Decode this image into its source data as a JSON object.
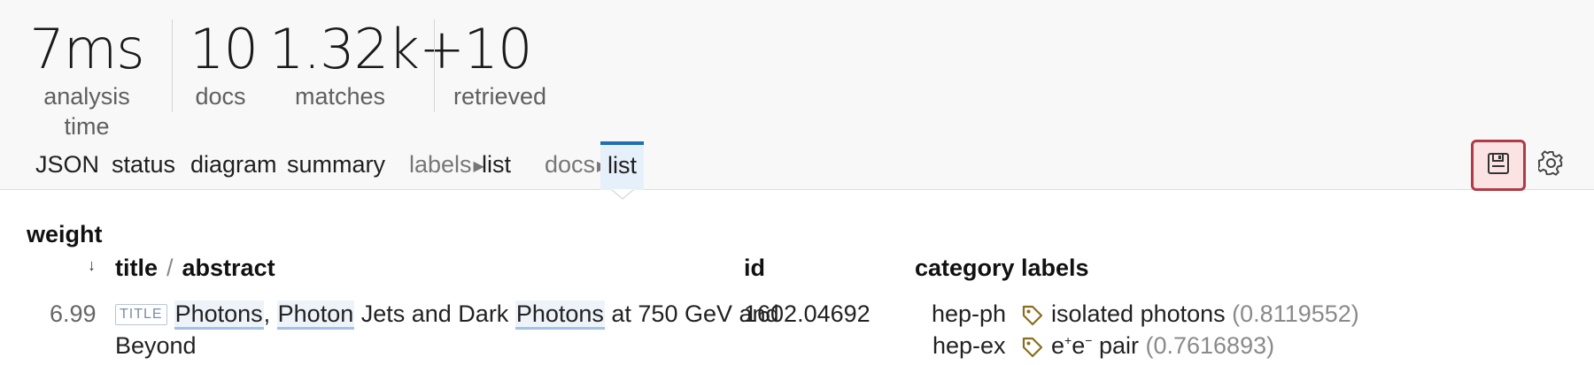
{
  "stats": [
    {
      "value": "7ms",
      "label": "analysis time"
    },
    {
      "value": "10",
      "label": "docs"
    },
    {
      "value": "1.32k+",
      "label": "matches"
    },
    {
      "value": "10",
      "label": "retrieved"
    }
  ],
  "tabs": {
    "json": "JSON",
    "status": "status",
    "diagram": "diagram",
    "summary": "summary",
    "labels_group": "labels",
    "labels_list": "list",
    "docs_group": "docs",
    "docs_list": "list",
    "active": "docs_list"
  },
  "toolbar": {
    "save_icon": "floppy-disk-icon",
    "settings_icon": "gear-icon",
    "save_highlight_color": "#b03a46"
  },
  "table": {
    "headers": {
      "weight": "weight",
      "title": "title",
      "separator": "/",
      "abstract": "abstract",
      "id": "id",
      "category": "category",
      "labels": "labels"
    },
    "sort_indicator": "↓",
    "rows": [
      {
        "weight": "6.99",
        "title_badge": "TITLE",
        "title_parts": [
          "Photons",
          ", ",
          "Photon",
          " Jets and Dark ",
          "Photons",
          " at 750 GeV and"
        ],
        "title_line2": "Beyond",
        "id": "1602.04692",
        "categories": [
          "hep-ph",
          "hep-ex"
        ],
        "labels": [
          {
            "name": "isolated photons",
            "score": "(0.8119552)"
          },
          {
            "name_base1": "e",
            "sup1": "+",
            "name_base2": "e",
            "sup2": "−",
            "name_rest": " pair",
            "score": "(0.7616893)"
          }
        ]
      }
    ]
  },
  "colors": {
    "accent": "#1f6fb2",
    "highlight_underline": "#9ec3e6",
    "tag_icon": "#8a6d1e"
  }
}
